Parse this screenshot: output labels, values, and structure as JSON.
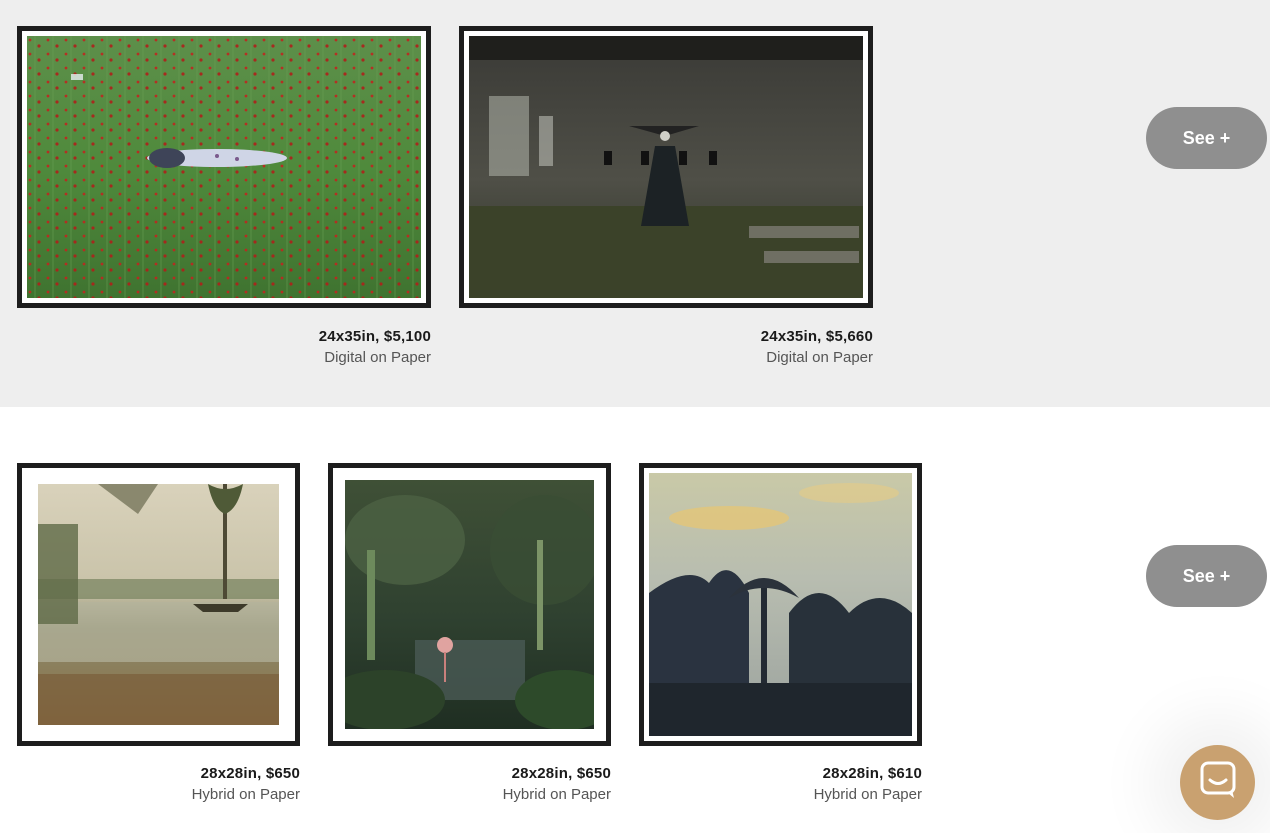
{
  "rows": [
    {
      "see_label": "See +",
      "artworks": [
        {
          "size_price": "24x35in,  $5,100",
          "medium": "Digital on Paper"
        },
        {
          "size_price": "24x35in,  $5,660",
          "medium": "Digital on Paper"
        }
      ]
    },
    {
      "see_label": "See +",
      "artworks": [
        {
          "size_price": "28x28in,  $650",
          "medium": "Hybrid on Paper"
        },
        {
          "size_price": "28x28in,  $650",
          "medium": "Hybrid on Paper"
        },
        {
          "size_price": "28x28in,  $610",
          "medium": "Hybrid on Paper"
        }
      ]
    }
  ],
  "icons": {
    "chat": "chat-bubble-icon"
  },
  "colors": {
    "accent_chat": "#c9a170",
    "button_gray": "#8f8f8f",
    "frame": "#1d1d1d",
    "band_gray": "#eeeeee"
  }
}
